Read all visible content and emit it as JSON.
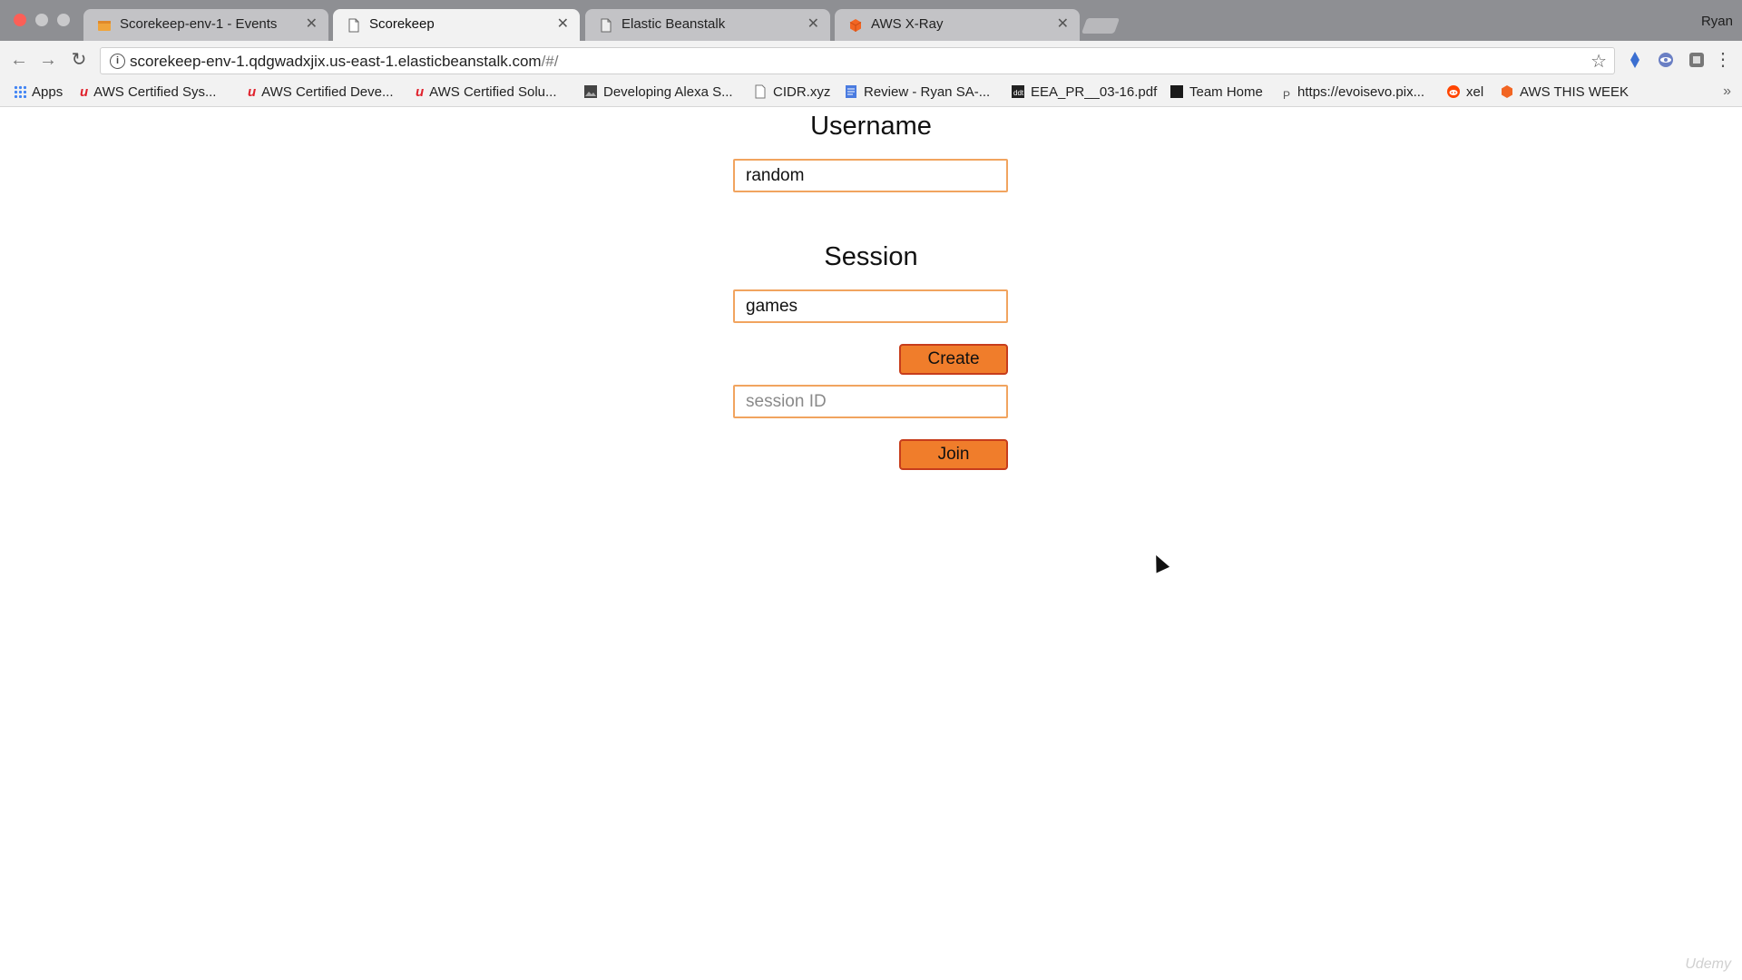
{
  "window": {
    "user": "Ryan",
    "tabs": [
      {
        "title": "Scorekeep-env-1 - Events",
        "icon": "aws-box-icon",
        "active": false
      },
      {
        "title": "Scorekeep",
        "icon": "page-icon",
        "active": true
      },
      {
        "title": "Elastic Beanstalk",
        "icon": "page-icon",
        "active": false
      },
      {
        "title": "AWS X-Ray",
        "icon": "aws-cube-icon",
        "active": false
      }
    ]
  },
  "address_bar": {
    "url_host": "scorekeep-env-1.qdgwadxjix.us-east-1.elasticbeanstalk.com",
    "url_path": "/#/"
  },
  "bookmarks": [
    {
      "label": "Apps",
      "icon": "apps-grid-icon"
    },
    {
      "label": "AWS Certified Sys...",
      "icon": "udemy-icon"
    },
    {
      "label": "AWS Certified Deve...",
      "icon": "udemy-icon"
    },
    {
      "label": "AWS Certified Solu...",
      "icon": "udemy-icon"
    },
    {
      "label": "Developing Alexa S...",
      "icon": "image-icon"
    },
    {
      "label": "CIDR.xyz",
      "icon": "page-icon"
    },
    {
      "label": "Review - Ryan SA-...",
      "icon": "doc-icon"
    },
    {
      "label": "EEA_PR__03-16.pdf",
      "icon": "pdf-icon"
    },
    {
      "label": "Team Home",
      "icon": "team-icon"
    },
    {
      "label": "https://evoisevo.pix...",
      "icon": "p-icon"
    },
    {
      "label": "xel",
      "icon": "reddit-icon"
    },
    {
      "label": "AWS THIS WEEK",
      "icon": "aws-cube-icon"
    }
  ],
  "form": {
    "username_label": "Username",
    "username_value": "random",
    "session_label": "Session",
    "session_value": "games",
    "create_label": "Create",
    "session_id_placeholder": "session ID",
    "join_label": "Join"
  },
  "watermark": "Udemy",
  "colors": {
    "button_fill": "#f07d2b",
    "button_border": "#c73d1c",
    "input_border": "#f1a45f"
  }
}
